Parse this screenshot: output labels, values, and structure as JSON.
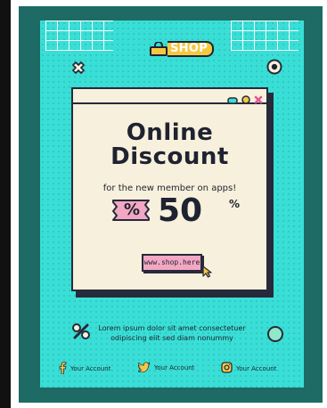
{
  "logo": {
    "text": "SHOP"
  },
  "window": {
    "headline_line1": "Online",
    "headline_line2": "Discount",
    "subtitle": "for the new member on apps!",
    "ticket_symbol": "%",
    "discount_value": "50",
    "discount_suffix": "%",
    "url_button": "www.shop.here"
  },
  "body_text": "Lorem ipsum dolor sit amet consectetuer odipiscing elit sed diam nonummy",
  "socials": [
    {
      "icon": "facebook-icon",
      "label": "Your Account"
    },
    {
      "icon": "twitter-icon",
      "label": "Your Account"
    },
    {
      "icon": "instagram-icon",
      "label": "Your Account"
    }
  ],
  "colors": {
    "poster_bg": "#39dfd6",
    "frame": "#1d6b64",
    "window_bg": "#f7f0dc",
    "ink": "#262a3a",
    "accent_pink": "#f2a7c3",
    "accent_yellow": "#f5c842"
  }
}
